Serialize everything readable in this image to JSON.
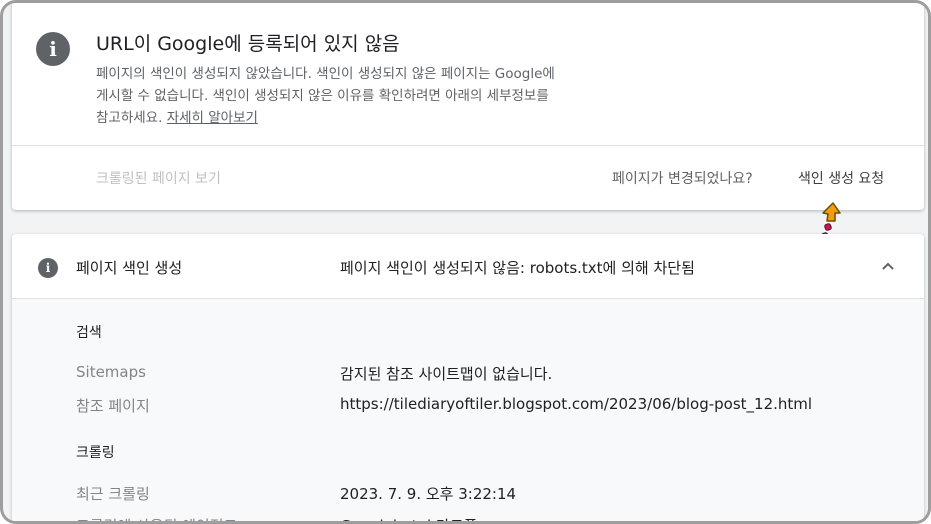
{
  "header": {
    "title": "URL이 Google에 등록되어 있지 않음",
    "description_line1": "페이지의 색인이 생성되지 않았습니다. 색인이 생성되지 않은 페이지는 Google에",
    "description_line2": "게시할 수 없습니다. 색인이 생성되지 않은 이유를 확인하려면 아래의 세부정보를",
    "description_line3": "참고하세요.",
    "learn_more": "자세히 알아보기"
  },
  "actions": {
    "view_crawled": "크롤링된 페이지 보기",
    "changed_question": "페이지가 변경되었나요?",
    "request_indexing": "색인 생성 요청"
  },
  "indexing_section": {
    "label": "페이지 색인 생성",
    "status": "페이지 색인이 생성되지 않음: robots.txt에 의해 차단됨"
  },
  "discovery": {
    "title": "검색",
    "rows": [
      {
        "label": "Sitemaps",
        "value": "감지된 참조 사이트맵이 없습니다."
      },
      {
        "label": "참조 페이지",
        "value": "https://tilediaryoftiler.blogspot.com/2023/06/blog-post_12.html"
      }
    ]
  },
  "crawl": {
    "title": "크롤링",
    "rows": [
      {
        "label": "최근 크롤링",
        "value": "2023. 7. 9. 오후 3:22:14"
      },
      {
        "label": "크롤링에 사용된 에이전트",
        "value": "Googlebot 스마트폰"
      }
    ]
  },
  "colors": {
    "icon_gray": "#5f6368",
    "arrow_orange": "#f39c12",
    "arrow_dots": "#c2185b"
  }
}
